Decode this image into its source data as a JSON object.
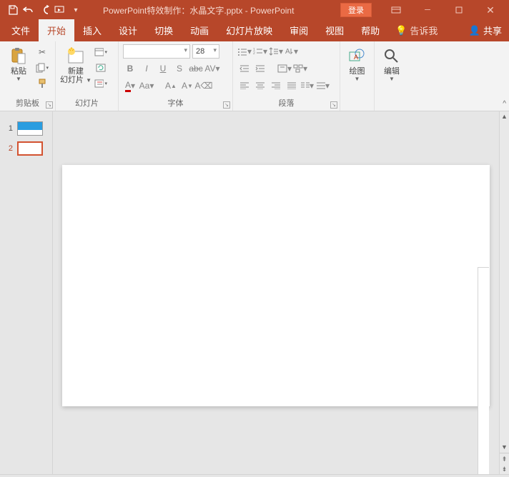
{
  "titlebar": {
    "doc_title": "PowerPoint特效制作：水晶文字.pptx  -  PowerPoint",
    "login": "登录"
  },
  "tabs": {
    "file": "文件",
    "home": "开始",
    "insert": "插入",
    "design": "设计",
    "transitions": "切换",
    "animations": "动画",
    "slideshow": "幻灯片放映",
    "review": "审阅",
    "view": "视图",
    "help": "帮助",
    "tellme": "告诉我",
    "share": "共享"
  },
  "ribbon": {
    "clipboard": {
      "label": "剪贴板",
      "paste": "粘贴"
    },
    "slides": {
      "label": "幻灯片",
      "new1": "新建",
      "new2": "幻灯片"
    },
    "font": {
      "label": "字体",
      "size": "28"
    },
    "paragraph": {
      "label": "段落"
    },
    "drawing": {
      "label": "绘图"
    },
    "editing": {
      "label": "编辑"
    }
  },
  "thumbs": [
    {
      "num": "1"
    },
    {
      "num": "2"
    }
  ]
}
